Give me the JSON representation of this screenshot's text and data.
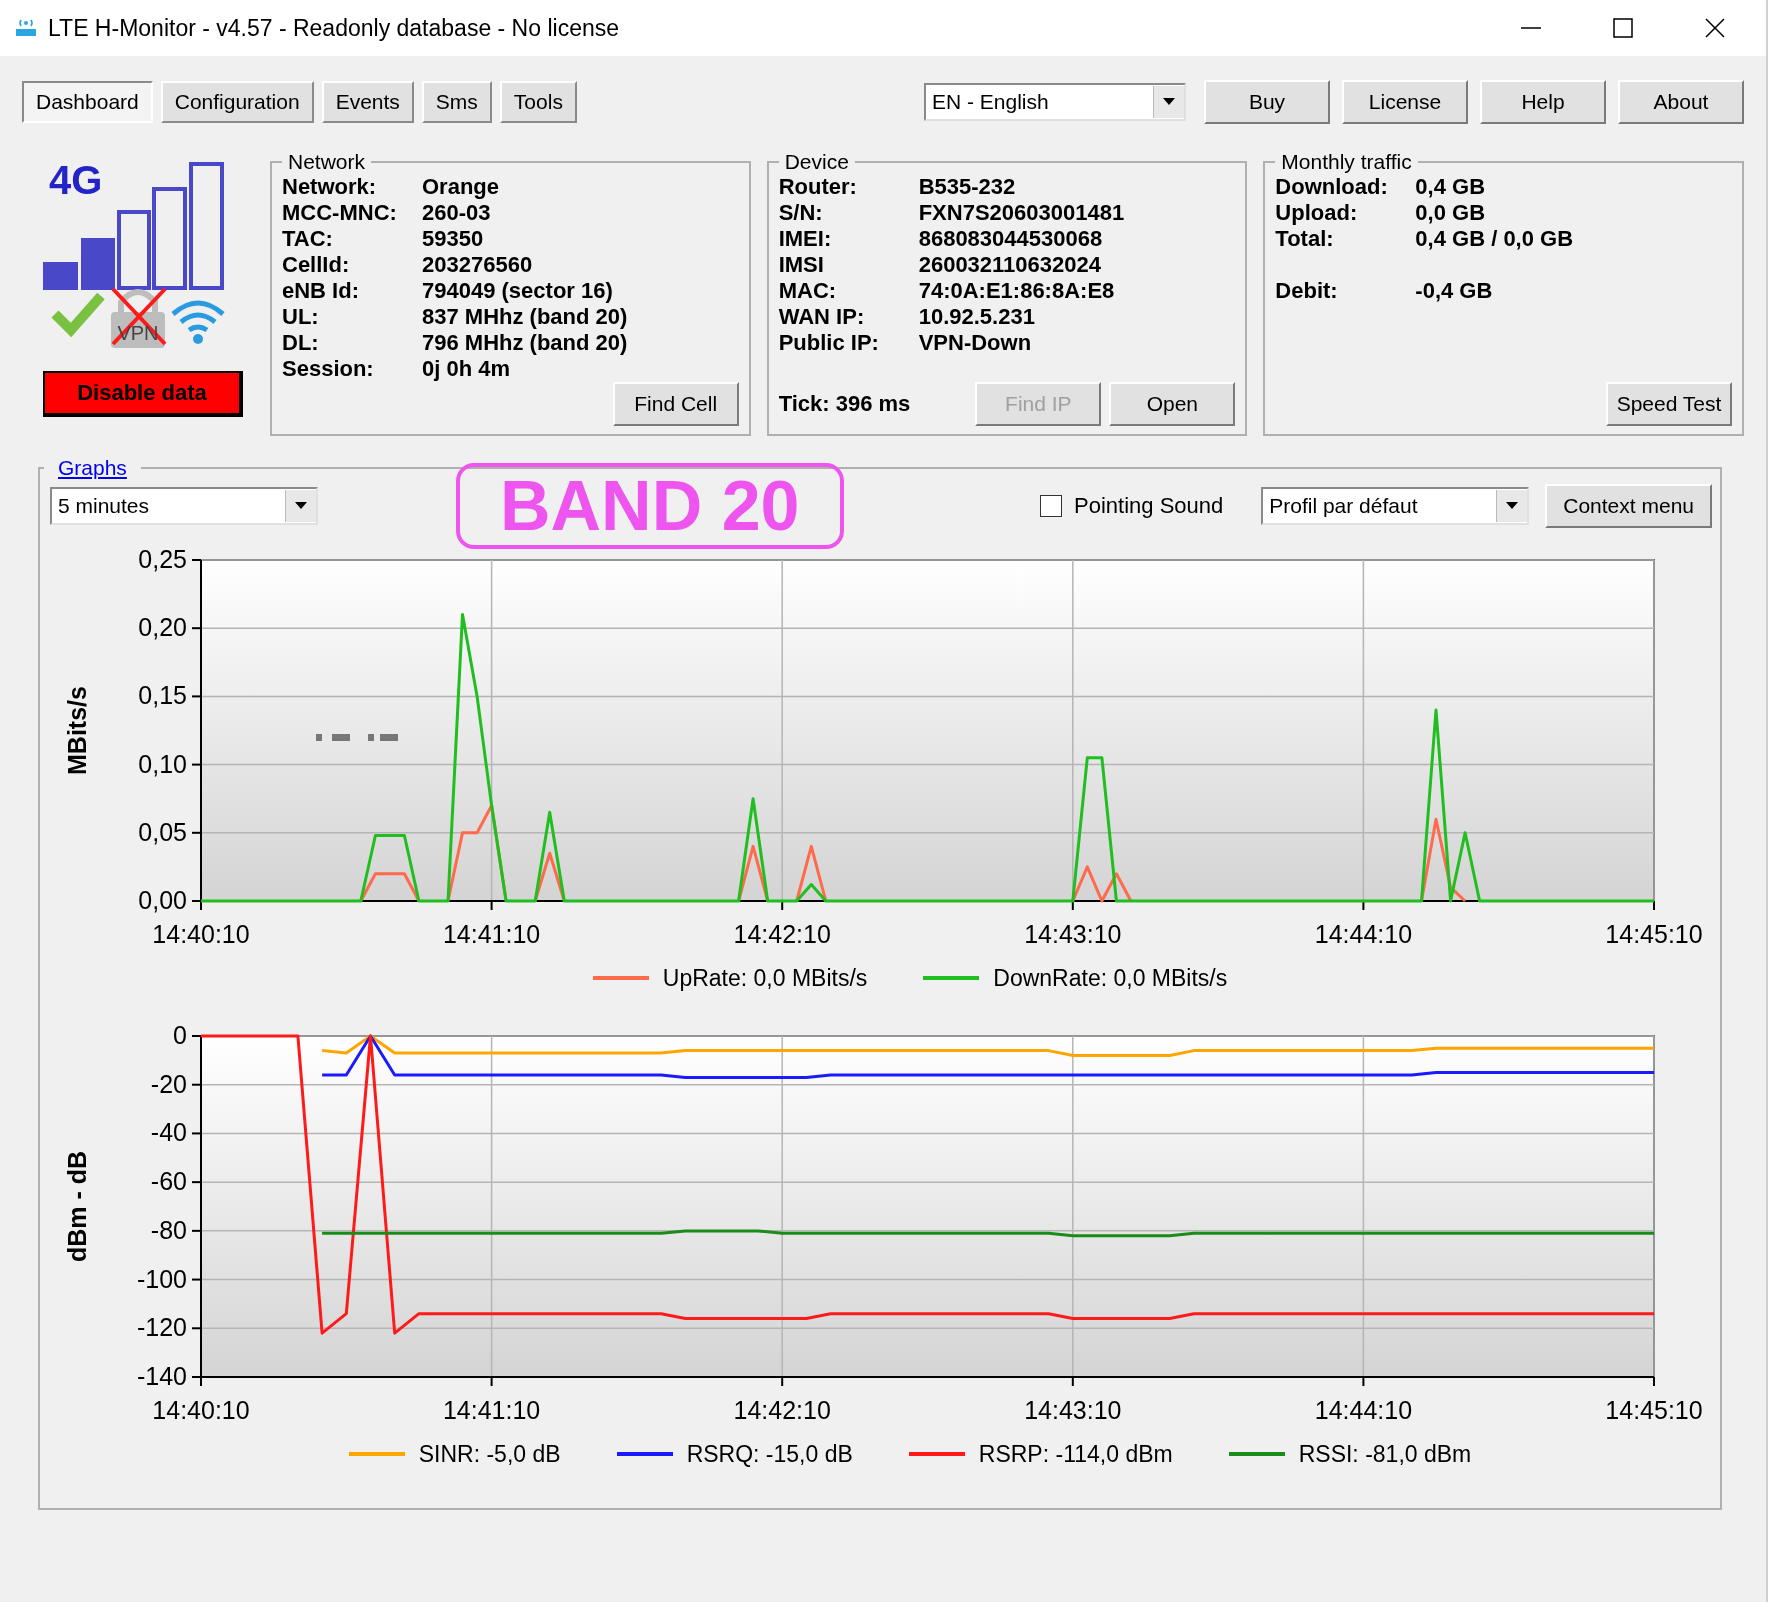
{
  "window": {
    "title": "LTE H-Monitor - v4.57 - Readonly database - No license"
  },
  "tabs": [
    {
      "label": "Dashboard",
      "selected": true
    },
    {
      "label": "Configuration",
      "selected": false
    },
    {
      "label": "Events",
      "selected": false
    },
    {
      "label": "Sms",
      "selected": false
    },
    {
      "label": "Tools",
      "selected": false
    }
  ],
  "language": {
    "value": "EN - English"
  },
  "buttons": [
    "Buy",
    "License",
    "Help",
    "About"
  ],
  "status": {
    "technology": "4G",
    "vpn_label": "VPN",
    "disable_button": "Disable data"
  },
  "network": {
    "title": "Network",
    "rows": [
      {
        "label": "Network:",
        "value": "Orange"
      },
      {
        "label": "MCC-MNC:",
        "value": "260-03"
      },
      {
        "label": "TAC:",
        "value": "59350"
      },
      {
        "label": "CellId:",
        "value": "203276560"
      },
      {
        "label": "eNB Id:",
        "value": "794049 (sector 16)"
      },
      {
        "label": "UL:",
        "value": "837 MHhz (band 20)"
      },
      {
        "label": "DL:",
        "value": "796 MHhz (band 20)"
      },
      {
        "label": "Session:",
        "value": "0j 0h 4m"
      }
    ],
    "button": "Find Cell"
  },
  "device": {
    "title": "Device",
    "rows": [
      {
        "label": "Router:",
        "value": "B535-232"
      },
      {
        "label": "S/N:",
        "value": "FXN7S20603001481"
      },
      {
        "label": "IMEI:",
        "value": "868083044530068"
      },
      {
        "label": "IMSI",
        "value": "260032110632024"
      },
      {
        "label": "MAC:",
        "value": "74:0A:E1:86:8A:E8"
      },
      {
        "label": "WAN IP:",
        "value": "10.92.5.231"
      },
      {
        "label": "Public IP:",
        "value": "VPN-Down"
      }
    ],
    "tick": "Tick: 396 ms",
    "buttons": [
      {
        "label": "Find IP",
        "disabled": true
      },
      {
        "label": "Open",
        "disabled": false
      }
    ]
  },
  "monthly_traffic": {
    "title": "Monthly traffic",
    "rows": [
      {
        "label": "Download:",
        "value": "0,4 GB"
      },
      {
        "label": "Upload:",
        "value": "0,0 GB"
      },
      {
        "label": "Total:",
        "value": "0,4 GB / 0,0 GB"
      }
    ],
    "debit": {
      "label": "Debit:",
      "value": "-0,4 GB"
    },
    "button": "Speed Test"
  },
  "graphs": {
    "title": "Graphs",
    "period": {
      "value": "5 minutes"
    },
    "annotation": "BAND 20",
    "pointing_sound": {
      "label": "Pointing Sound",
      "checked": false
    },
    "profile": {
      "value": "Profil par défaut"
    },
    "context_button": "Context menu",
    "charts": [
      {
        "chart_data": {
          "type": "line",
          "grid": true,
          "legend": true,
          "ylabel": "MBits/s",
          "ylim": [
            0,
            0.25
          ],
          "yticks": [
            {
              "value": 0,
              "label": "0,00"
            },
            {
              "value": 0.05,
              "label": "0,05"
            },
            {
              "value": 0.1,
              "label": "0,10"
            },
            {
              "value": 0.15,
              "label": "0,15"
            },
            {
              "value": 0.2,
              "label": "0,20"
            },
            {
              "value": 0.25,
              "label": "0,25"
            }
          ],
          "categories": [
            "14:40:10",
            null,
            null,
            null,
            null,
            null,
            null,
            null,
            null,
            null,
            null,
            null,
            null,
            null,
            null,
            null,
            null,
            null,
            null,
            null,
            "14:41:10",
            null,
            null,
            null,
            null,
            null,
            null,
            null,
            null,
            null,
            null,
            null,
            null,
            null,
            null,
            null,
            null,
            null,
            null,
            null,
            "14:42:10",
            null,
            null,
            null,
            null,
            null,
            null,
            null,
            null,
            null,
            null,
            null,
            null,
            null,
            null,
            null,
            null,
            null,
            null,
            null,
            "14:43:10",
            null,
            null,
            null,
            null,
            null,
            null,
            null,
            null,
            null,
            null,
            null,
            null,
            null,
            null,
            null,
            null,
            null,
            null,
            null,
            "14:44:10",
            null,
            null,
            null,
            null,
            null,
            null,
            null,
            null,
            null,
            null,
            null,
            null,
            null,
            null,
            null,
            null,
            null,
            null,
            null,
            "14:45:10"
          ],
          "series": [
            {
              "name": "UpRate: 0,0 MBits/s",
              "color": "#ff6a4d",
              "values": [
                null,
                null,
                null,
                null,
                null,
                null,
                null,
                null,
                null,
                null,
                null,
                0,
                0.02,
                0.02,
                0.02,
                0,
                null,
                0,
                0.05,
                0.05,
                0.07,
                0,
                null,
                0,
                0.035,
                0,
                null,
                null,
                null,
                null,
                null,
                null,
                null,
                null,
                null,
                null,
                null,
                0,
                0.04,
                0,
                null,
                0,
                0.04,
                0,
                null,
                null,
                null,
                null,
                null,
                null,
                null,
                null,
                null,
                null,
                null,
                null,
                null,
                null,
                null,
                null,
                0,
                0.025,
                0,
                0.02,
                0,
                null,
                null,
                null,
                null,
                null,
                null,
                null,
                null,
                null,
                null,
                null,
                null,
                null,
                null,
                null,
                null,
                null,
                null,
                null,
                0,
                0.06,
                0.01,
                0,
                null,
                null,
                null,
                null,
                null,
                null,
                null,
                null,
                null,
                null,
                null,
                null,
                null
              ]
            },
            {
              "name": "DownRate: 0,0 MBits/s",
              "color": "#1fbf1f",
              "values": [
                0,
                0,
                0,
                0,
                0,
                0,
                0,
                0,
                0,
                0,
                0,
                0,
                0.048,
                0.048,
                0.048,
                0,
                0,
                0,
                0.21,
                0.15,
                0.07,
                0,
                0,
                0,
                0.065,
                0,
                0,
                0,
                0,
                0,
                0,
                0,
                0,
                0,
                0,
                0,
                0,
                0,
                0.075,
                0,
                0,
                0,
                0.012,
                0,
                0,
                0,
                0,
                0,
                0,
                0,
                0,
                0,
                0,
                0,
                0,
                0,
                0,
                0,
                0,
                0,
                0,
                0.105,
                0.105,
                0,
                0,
                0,
                0,
                0,
                0,
                0,
                0,
                0,
                0,
                0,
                0,
                0,
                0,
                0,
                0,
                0,
                0,
                0,
                0,
                0,
                0,
                0.14,
                0,
                0.05,
                0,
                0,
                0,
                0,
                0,
                0,
                0,
                0,
                0,
                0,
                0,
                0,
                0
              ]
            }
          ]
        }
      },
      {
        "chart_data": {
          "type": "line",
          "grid": true,
          "legend": true,
          "ylabel": "dBm - dB",
          "ylim": [
            -140,
            0
          ],
          "yticks": [
            0,
            -20,
            -40,
            -60,
            -80,
            -100,
            -120,
            -140
          ],
          "categories": [
            "14:40:10",
            null,
            null,
            null,
            null,
            null,
            null,
            null,
            null,
            null,
            null,
            null,
            "14:41:10",
            null,
            null,
            null,
            null,
            null,
            null,
            null,
            null,
            null,
            null,
            null,
            "14:42:10",
            null,
            null,
            null,
            null,
            null,
            null,
            null,
            null,
            null,
            null,
            null,
            "14:43:10",
            null,
            null,
            null,
            null,
            null,
            null,
            null,
            null,
            null,
            null,
            null,
            "14:44:10",
            null,
            null,
            null,
            null,
            null,
            null,
            null,
            null,
            null,
            null,
            null,
            "14:45:10"
          ],
          "series": [
            {
              "name": "SINR: -5,0 dB",
              "color": "#ffa500",
              "values": [
                null,
                null,
                null,
                null,
                null,
                -6,
                -7,
                0,
                -7,
                -7,
                -7,
                -7,
                -7,
                -7,
                -7,
                -7,
                -7,
                -7,
                -7,
                -7,
                -6,
                -6,
                -6,
                -6,
                -6,
                -6,
                -6,
                -6,
                -6,
                -6,
                -6,
                -6,
                -6,
                -6,
                -6,
                -6,
                -8,
                -8,
                -8,
                -8,
                -8,
                -6,
                -6,
                -6,
                -6,
                -6,
                -6,
                -6,
                -6,
                -6,
                -6,
                -5,
                -5,
                -5,
                -5,
                -5,
                -5,
                -5,
                -5,
                -5,
                -5
              ]
            },
            {
              "name": "RSRQ: -15,0 dB",
              "color": "#1a1aff",
              "values": [
                null,
                null,
                null,
                null,
                null,
                -16,
                -16,
                0,
                -16,
                -16,
                -16,
                -16,
                -16,
                -16,
                -16,
                -16,
                -16,
                -16,
                -16,
                -16,
                -17,
                -17,
                -17,
                -17,
                -17,
                -17,
                -16,
                -16,
                -16,
                -16,
                -16,
                -16,
                -16,
                -16,
                -16,
                -16,
                -16,
                -16,
                -16,
                -16,
                -16,
                -16,
                -16,
                -16,
                -16,
                -16,
                -16,
                -16,
                -16,
                -16,
                -16,
                -15,
                -15,
                -15,
                -15,
                -15,
                -15,
                -15,
                -15,
                -15,
                -15
              ]
            },
            {
              "name": "RSRP: -114,0 dBm",
              "color": "#ff1a1a",
              "values": [
                0,
                0,
                0,
                0,
                0,
                -122,
                -114,
                0,
                -122,
                -114,
                -114,
                -114,
                -114,
                -114,
                -114,
                -114,
                -114,
                -114,
                -114,
                -114,
                -116,
                -116,
                -116,
                -116,
                -116,
                -116,
                -114,
                -114,
                -114,
                -114,
                -114,
                -114,
                -114,
                -114,
                -114,
                -114,
                -116,
                -116,
                -116,
                -116,
                -116,
                -114,
                -114,
                -114,
                -114,
                -114,
                -114,
                -114,
                -114,
                -114,
                -114,
                -114,
                -114,
                -114,
                -114,
                -114,
                -114,
                -114,
                -114,
                -114,
                -114
              ]
            },
            {
              "name": "RSSI: -81,0 dBm",
              "color": "#1a8c1a",
              "values": [
                null,
                null,
                null,
                null,
                null,
                -81,
                -81,
                -81,
                -81,
                -81,
                -81,
                -81,
                -81,
                -81,
                -81,
                -81,
                -81,
                -81,
                -81,
                -81,
                -80,
                -80,
                -80,
                -80,
                -81,
                -81,
                -81,
                -81,
                -81,
                -81,
                -81,
                -81,
                -81,
                -81,
                -81,
                -81,
                -82,
                -82,
                -82,
                -82,
                -82,
                -81,
                -81,
                -81,
                -81,
                -81,
                -81,
                -81,
                -81,
                -81,
                -81,
                -81,
                -81,
                -81,
                -81,
                -81,
                -81,
                -81,
                -81,
                -81,
                -81
              ]
            }
          ]
        }
      }
    ]
  }
}
